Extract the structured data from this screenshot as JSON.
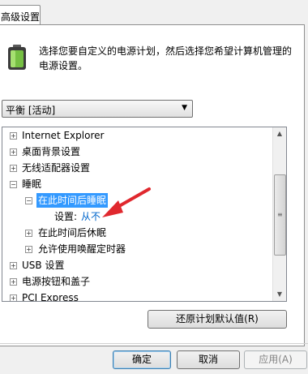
{
  "tab": {
    "label": "高级设置"
  },
  "description": "选择您要自定义的电源计划，然后选择您希望计算机管理的电源设置。",
  "plan_select": {
    "value": "平衡 [活动]"
  },
  "tree": {
    "items": [
      {
        "label": "Internet Explorer",
        "expander": "+"
      },
      {
        "label": "桌面背景设置",
        "expander": "+"
      },
      {
        "label": "无线适配器设置",
        "expander": "+"
      },
      {
        "label": "睡眠",
        "expander": "−"
      },
      {
        "label": "在此时间后睡眠",
        "expander": "−"
      },
      {
        "label": "设置:",
        "value": "从不"
      },
      {
        "label": "在此时间后休眠",
        "expander": "+"
      },
      {
        "label": "允许使用唤醒定时器",
        "expander": "+"
      },
      {
        "label": "USB 设置",
        "expander": "+"
      },
      {
        "label": "电源按钮和盖子",
        "expander": "+"
      },
      {
        "label": "PCI Express",
        "expander": "+"
      }
    ]
  },
  "buttons": {
    "restore_defaults": "还原计划默认值(R)",
    "ok": "确定",
    "cancel": "取消",
    "apply": "应用(A)"
  },
  "colors": {
    "selection": "#3399ff",
    "link": "#0066cc",
    "annotation": "#e0282e"
  },
  "icons": {
    "battery": "power-battery-icon",
    "scroll_up": "scroll-up-arrow-icon",
    "scroll_down": "scroll-down-arrow-icon",
    "dropdown": "chevron-down-icon"
  }
}
